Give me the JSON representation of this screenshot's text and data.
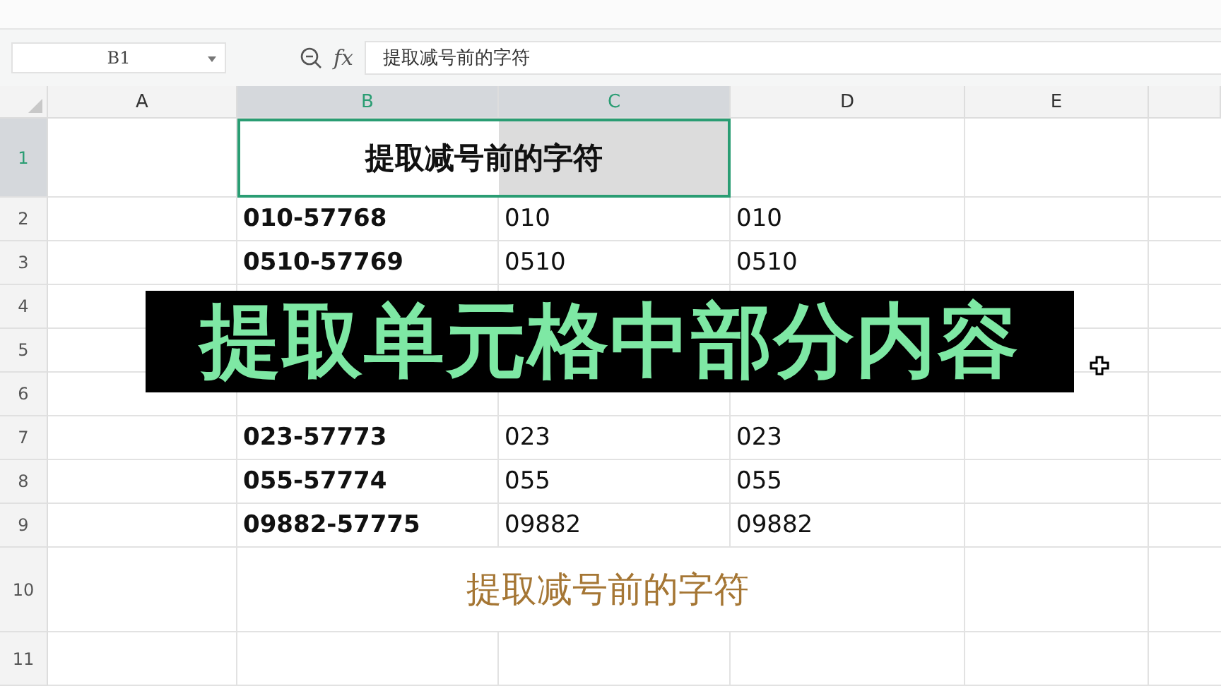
{
  "name_box": {
    "value": "B1"
  },
  "formula_bar": {
    "fx": "fx",
    "value": "提取减号前的字符"
  },
  "columns": [
    {
      "label": "A",
      "selected": false
    },
    {
      "label": "B",
      "selected": true
    },
    {
      "label": "C",
      "selected": true
    },
    {
      "label": "D",
      "selected": false
    },
    {
      "label": "E",
      "selected": false
    }
  ],
  "rows": [
    {
      "number": "1",
      "kind": "title",
      "selected": true,
      "text": "提取减号前的字符"
    },
    {
      "number": "2",
      "kind": "data",
      "selected": false,
      "b": "010-57768",
      "c": "010",
      "d": "010"
    },
    {
      "number": "3",
      "kind": "data",
      "selected": false,
      "b": "0510-57769",
      "c": "0510",
      "d": "0510"
    },
    {
      "number": "4",
      "kind": "empty",
      "selected": false
    },
    {
      "number": "5",
      "kind": "empty",
      "selected": false
    },
    {
      "number": "6",
      "kind": "empty",
      "selected": false
    },
    {
      "number": "7",
      "kind": "data",
      "selected": false,
      "b": "023-57773",
      "c": "023",
      "d": "023"
    },
    {
      "number": "8",
      "kind": "data",
      "selected": false,
      "b": "055-57774",
      "c": "055",
      "d": "055"
    },
    {
      "number": "9",
      "kind": "data",
      "selected": false,
      "b": "09882-57775",
      "c": "09882",
      "d": "09882"
    },
    {
      "number": "10",
      "kind": "note",
      "selected": false,
      "text": "提取减号前的字符"
    },
    {
      "number": "11",
      "kind": "empty",
      "selected": false
    }
  ],
  "overlay_caption": "提取单元格中部分内容"
}
